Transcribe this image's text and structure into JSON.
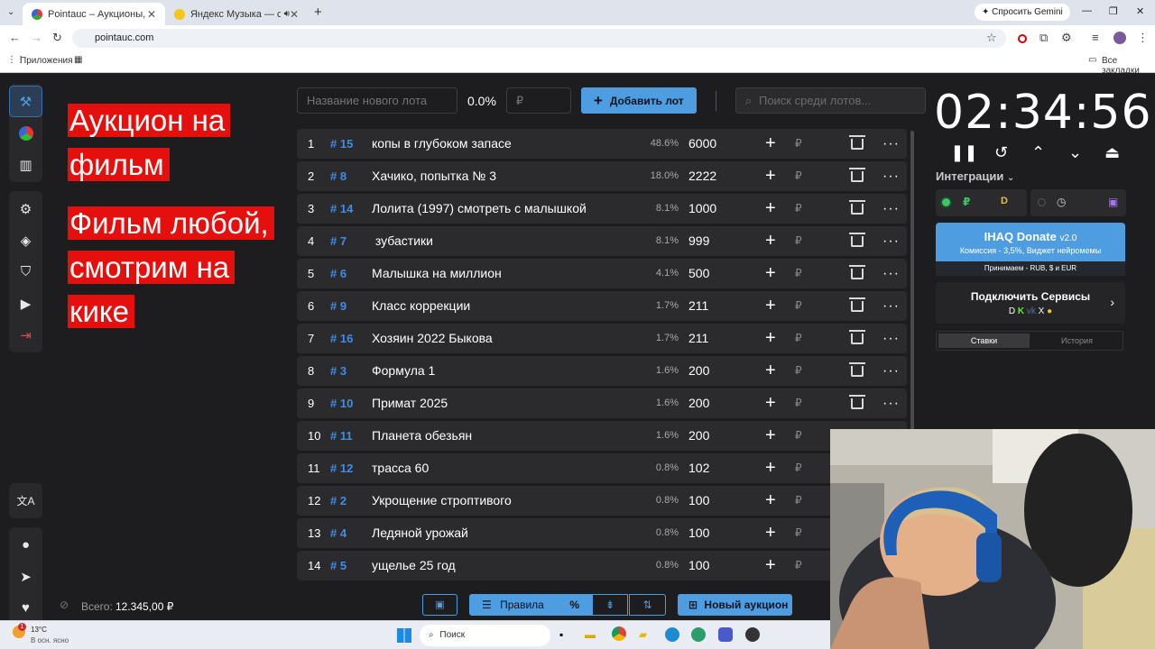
{
  "browser": {
    "tabs": [
      {
        "title": "Pointauc – Аукционы, лотерея",
        "active": true
      },
      {
        "title": "Яндекс Музыка — собирае",
        "active": false
      }
    ],
    "new_tab": "+",
    "url": "pointauc.com",
    "gemini": "Спросить Gemini",
    "bookmarks_apps": "Приложения",
    "all_bookmarks": "Все закладки"
  },
  "stream_title": [
    "Аукцион на фильм",
    "Фильм любой, смотрим на кике"
  ],
  "toolbar": {
    "lot_name_placeholder": "Название нового лота",
    "percent": "0.0%",
    "amount_placeholder": "₽",
    "add_lot": "Добавить лот",
    "search_placeholder": "Поиск среди лотов..."
  },
  "lots": [
    {
      "n": "1",
      "id": "# 15",
      "name": "копы в глубоком запасе",
      "pct": "48.6%",
      "amount": "6000"
    },
    {
      "n": "2",
      "id": "# 8",
      "name": "Хачико, попытка № 3",
      "pct": "18.0%",
      "amount": "2222"
    },
    {
      "n": "3",
      "id": "# 14",
      "name": "Лолита (1997) смотреть с малышкой",
      "pct": "8.1%",
      "amount": "1000"
    },
    {
      "n": "4",
      "id": "# 7",
      "name": " зубастики",
      "pct": "8.1%",
      "amount": "999"
    },
    {
      "n": "5",
      "id": "# 6",
      "name": "Малышка на миллион",
      "pct": "4.1%",
      "amount": "500"
    },
    {
      "n": "6",
      "id": "# 9",
      "name": "Класс коррекции",
      "pct": "1.7%",
      "amount": "211"
    },
    {
      "n": "7",
      "id": "# 16",
      "name": "Хозяин 2022 Быкова",
      "pct": "1.7%",
      "amount": "211"
    },
    {
      "n": "8",
      "id": "# 3",
      "name": "Формула 1",
      "pct": "1.6%",
      "amount": "200"
    },
    {
      "n": "9",
      "id": "# 10",
      "name": "Примат 2025",
      "pct": "1.6%",
      "amount": "200"
    },
    {
      "n": "10",
      "id": "# 11",
      "name": "Планета обезьян",
      "pct": "1.6%",
      "amount": "200"
    },
    {
      "n": "11",
      "id": "# 12",
      "name": "трасса 60",
      "pct": "0.8%",
      "amount": "102"
    },
    {
      "n": "12",
      "id": "# 2",
      "name": "Укрощение строптивого",
      "pct": "0.8%",
      "amount": "100"
    },
    {
      "n": "13",
      "id": "# 4",
      "name": "Ледяной урожай",
      "pct": "0.8%",
      "amount": "100"
    },
    {
      "n": "14",
      "id": "# 5",
      "name": "ущелье 25 год",
      "pct": "0.8%",
      "amount": "100"
    }
  ],
  "lot_actions": {
    "plus": "+",
    "currency": "₽",
    "more": "···"
  },
  "bottom": {
    "total_label": "Всего:",
    "total_value": "12.345,00 ₽",
    "rules": "Правила",
    "percent_icon": "%",
    "new_auction": "Новый аукцион"
  },
  "timer": "02:34:56",
  "integrations": "Интеграции",
  "donate": {
    "title": "IHAQ Donate",
    "version": "v2.0",
    "line": "Комиссия - 3,5%, Виджет нейромемы",
    "accept": "Принимаем - RUB, $ и EUR"
  },
  "services": {
    "title": "Подключить Сервисы"
  },
  "history_tabs": [
    "Ставки",
    "История"
  ],
  "weather": {
    "temp": "13°C",
    "desc": "В осн. ясно"
  },
  "taskbar_search": "Поиск",
  "colors": {
    "accent": "#4d9de0",
    "title_bg": "#e5100d",
    "lot_id": "#3d8ee8",
    "bg": "#1d1d1f"
  }
}
